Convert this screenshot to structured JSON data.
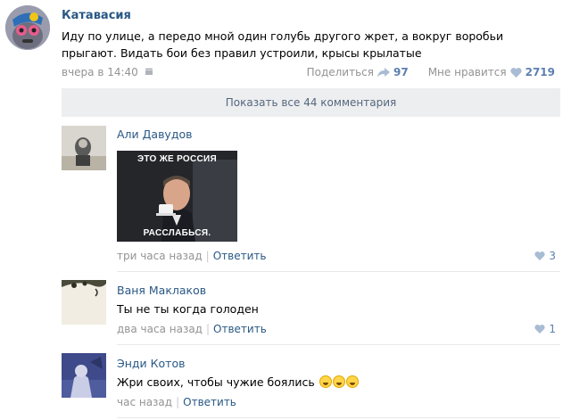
{
  "post": {
    "author": "Катавасия",
    "text": "Иду по улице, а передо мной один голубь другого жрет, а вокруг воробьи прыгают. Видать бои без правил устроили, крысы крылатые",
    "time": "вчера в 14:40",
    "share_label": "Поделиться",
    "share_count": "97",
    "like_label": "Мне нравится",
    "like_count": "2719"
  },
  "show_all_label": "Показать все 44 комментария",
  "comments": [
    {
      "author": "Али Давудов",
      "image_top_text": "ЭТО ЖЕ РОССИЯ",
      "image_bottom_text": "РАССЛАБЬСЯ.",
      "time": "три часа назад",
      "reply_label": "Ответить",
      "likes": "3"
    },
    {
      "author": "Ваня Маклаков",
      "text": "Ты не ты когда голоден",
      "time": "два часа назад",
      "reply_label": "Ответить",
      "likes": "1"
    },
    {
      "author": "Энди Котов",
      "text": "Жри своих, чтобы чужие боялись",
      "time": "час назад",
      "reply_label": "Ответить"
    }
  ],
  "colors": {
    "link": "#2a5885",
    "meta": "#939393",
    "like_accent": "#5c7fb1",
    "show_all_bg": "#edeef0"
  }
}
